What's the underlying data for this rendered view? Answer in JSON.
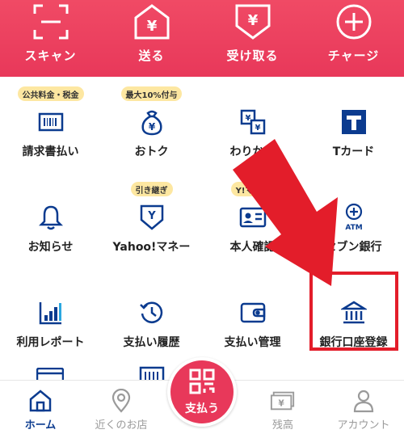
{
  "header": {
    "items": [
      {
        "label": "スキャン",
        "icon": "scan-icon"
      },
      {
        "label": "送る",
        "icon": "send-icon"
      },
      {
        "label": "受け取る",
        "icon": "receive-icon"
      },
      {
        "label": "チャージ",
        "icon": "charge-icon"
      }
    ]
  },
  "grid": {
    "items": [
      {
        "label": "請求書払い",
        "badge": "公共料金・税金",
        "icon": "barcode-bill-icon"
      },
      {
        "label": "おトク",
        "badge": "最大10%付与",
        "icon": "money-bag-icon"
      },
      {
        "label": "わりかん",
        "badge": "",
        "icon": "split-bill-icon"
      },
      {
        "label": "Tカード",
        "badge": "",
        "icon": "t-card-icon"
      },
      {
        "label": "お知らせ",
        "badge": "",
        "icon": "bell-icon"
      },
      {
        "label": "Yahoo!マネー",
        "badge": "引き継ぎ",
        "icon": "yahoo-money-icon"
      },
      {
        "label": "本人確認",
        "badge": "Y!マネー",
        "icon": "id-card-icon"
      },
      {
        "label": "セブン銀行",
        "badge": "",
        "icon": "atm-icon",
        "icon_text": "ATM"
      },
      {
        "label": "利用レポート",
        "badge": "",
        "icon": "report-chart-icon"
      },
      {
        "label": "支払い履歴",
        "badge": "",
        "icon": "history-clock-icon"
      },
      {
        "label": "支払い管理",
        "badge": "",
        "icon": "wallet-icon"
      },
      {
        "label": "銀行口座登録",
        "badge": "",
        "icon": "bank-icon"
      }
    ]
  },
  "bottom_nav": {
    "items": [
      {
        "label": "ホーム",
        "icon": "home-icon",
        "active": true
      },
      {
        "label": "近くのお店",
        "icon": "location-pin-icon",
        "active": false
      },
      {
        "label": "残高",
        "icon": "balance-icon",
        "active": false
      },
      {
        "label": "アカウント",
        "icon": "account-icon",
        "active": false
      }
    ],
    "pay_label": "支払う"
  },
  "colors": {
    "brand_red": "#e8385a",
    "icon_navy": "#0b3b8f",
    "badge_yellow": "#fde7a1",
    "annotation_red": "#e31d2a"
  }
}
